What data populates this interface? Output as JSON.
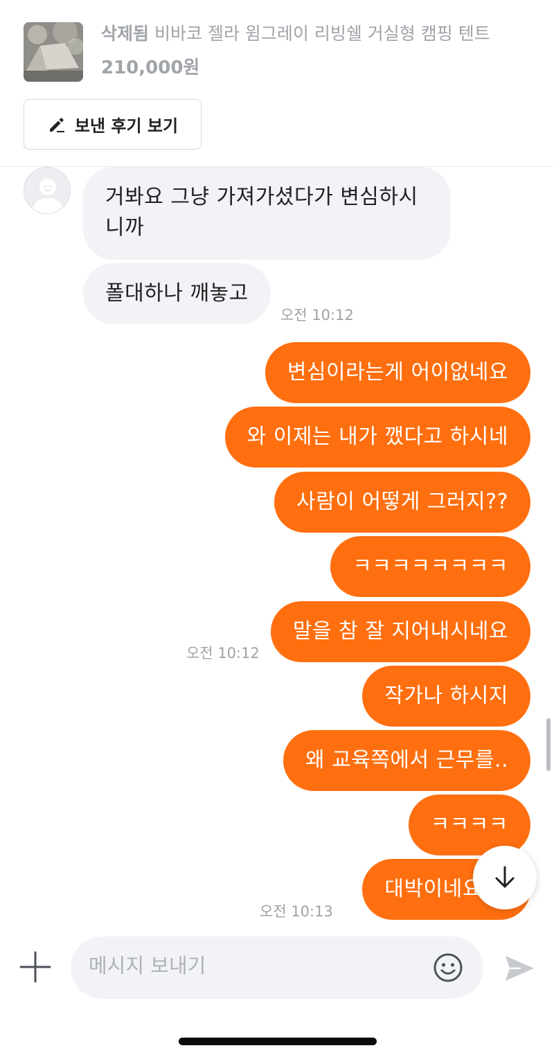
{
  "product": {
    "status": "삭제됨",
    "title": "비바코 젤라 윔그레이 리빙쉘 거실형 캠핑 텐트",
    "price": "210,000원",
    "review_button": "보낸 후기 보기"
  },
  "messages": [
    {
      "from": "other",
      "text_line1": "거봐요 그냥 가져가셨다가 변심하시",
      "text_line2": "니까"
    },
    {
      "from": "other",
      "text": "폴대하나 깨놓고",
      "time": "오전 10:12"
    },
    {
      "from": "me",
      "text": "변심이라는게 어이없네요"
    },
    {
      "from": "me",
      "text": "와 이제는 내가 깼다고 하시네"
    },
    {
      "from": "me",
      "text": "사람이 어떻게 그러지??"
    },
    {
      "from": "me",
      "text": "ㅋㅋㅋㅋㅋㅋㅋㅋ"
    },
    {
      "from": "me",
      "text": "말을 참 잘 지어내시네요",
      "time": "오전 10:12"
    },
    {
      "from": "me",
      "text": "작가나 하시지"
    },
    {
      "from": "me",
      "text": "왜 교육쪽에서 근무를.."
    },
    {
      "from": "me",
      "text": "ㅋㅋㅋㅋ"
    },
    {
      "from": "me",
      "text": "대박이네요 진",
      "time": "오전 10:13"
    }
  ],
  "input": {
    "placeholder": "메시지 보내기"
  },
  "icons": {
    "review": "pencil-icon",
    "add": "plus-icon",
    "emoji": "smiley-icon",
    "send": "send-icon",
    "scroll_down": "arrow-down-icon",
    "avatar": "default-user-icon"
  },
  "colors": {
    "sent_bubble": "#ff6f0f",
    "received_bubble": "#f2f3f6",
    "muted_text": "#9ea2a7"
  }
}
